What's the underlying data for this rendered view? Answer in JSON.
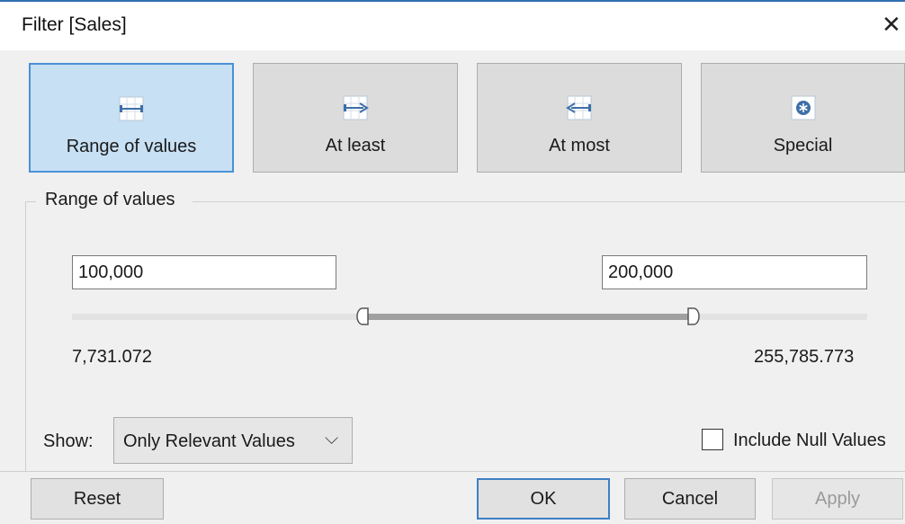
{
  "window": {
    "title": "Filter [Sales]",
    "close_icon": "close-icon"
  },
  "modes": [
    {
      "label": "Range of values",
      "icon": "range-icon",
      "selected": true
    },
    {
      "label": "At least",
      "icon": "at-least-icon",
      "selected": false
    },
    {
      "label": "At most",
      "icon": "at-most-icon",
      "selected": false
    },
    {
      "label": "Special",
      "icon": "special-icon",
      "selected": false
    }
  ],
  "range": {
    "group_label": "Range of values",
    "min_input": "100,000",
    "max_input": "200,000",
    "data_min": "7,731.072",
    "data_max": "255,785.773"
  },
  "show": {
    "label": "Show:",
    "selected": "Only Relevant Values"
  },
  "include_null": {
    "label": "Include Null Values",
    "checked": false
  },
  "buttons": {
    "reset": "Reset",
    "ok": "OK",
    "cancel": "Cancel",
    "apply": "Apply"
  },
  "colors": {
    "selected_mode_bg": "#c7e0f4",
    "selected_mode_border": "#4a90d6",
    "title_accent": "#2f6fb0"
  }
}
